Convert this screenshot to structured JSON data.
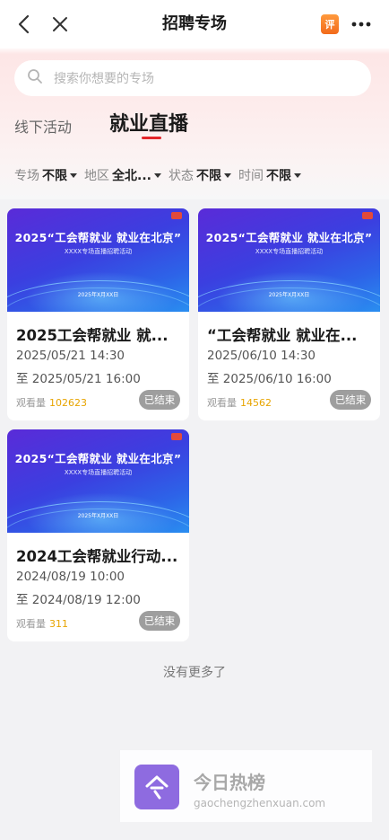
{
  "header": {
    "title": "招聘专场",
    "back_icon": "chevron-left-icon",
    "close_icon": "close-icon",
    "review_badge": "评",
    "more_icon": "more-horizontal-icon"
  },
  "search": {
    "placeholder": "搜索你想要的专场",
    "icon": "search-icon"
  },
  "tabs": [
    {
      "label": "线下活动",
      "active": false
    },
    {
      "label": "就业直播",
      "active": true
    }
  ],
  "filters": [
    {
      "label": "专场",
      "value": "不限"
    },
    {
      "label": "地区",
      "value": "全北..."
    },
    {
      "label": "状态",
      "value": "不限"
    },
    {
      "label": "时间",
      "value": "不限"
    }
  ],
  "cards": [
    {
      "banner_title": "2025“工会帮就业 就业在北京”",
      "banner_sub": "XXXX专场直播招聘活动",
      "banner_date": "2025年X月XX日",
      "title": "2025工会帮就业 就...",
      "start": "2025/05/21 14:30",
      "end": "至 2025/05/21 16:00",
      "views_label": "观看量",
      "views": "102623",
      "status": "已结束"
    },
    {
      "banner_title": "2025“工会帮就业 就业在北京”",
      "banner_sub": "XXXX专场直播招聘活动",
      "banner_date": "2025年X月XX日",
      "title": "“工会帮就业 就业在...",
      "start": "2025/06/10 14:30",
      "end": "至 2025/06/10 16:00",
      "views_label": "观看量",
      "views": "14562",
      "status": "已结束"
    },
    {
      "banner_title": "2025“工会帮就业 就业在北京”",
      "banner_sub": "XXXX专场直播招聘活动",
      "banner_date": "2025年X月XX日",
      "title": "2024工会帮就业行动...",
      "start": "2024/08/19 10:00",
      "end": "至 2024/08/19 12:00",
      "views_label": "观看量",
      "views": "311",
      "status": "已结束"
    }
  ],
  "footer": {
    "no_more": "没有更多了"
  },
  "watermark": {
    "title": "今日热榜",
    "url": "gaochengzhenxuan.com",
    "glyph": "今"
  },
  "colors": {
    "accent": "#e3262b",
    "views": "#e7a400",
    "banner_from": "#5a2bd8",
    "banner_to": "#2a8ef0"
  }
}
